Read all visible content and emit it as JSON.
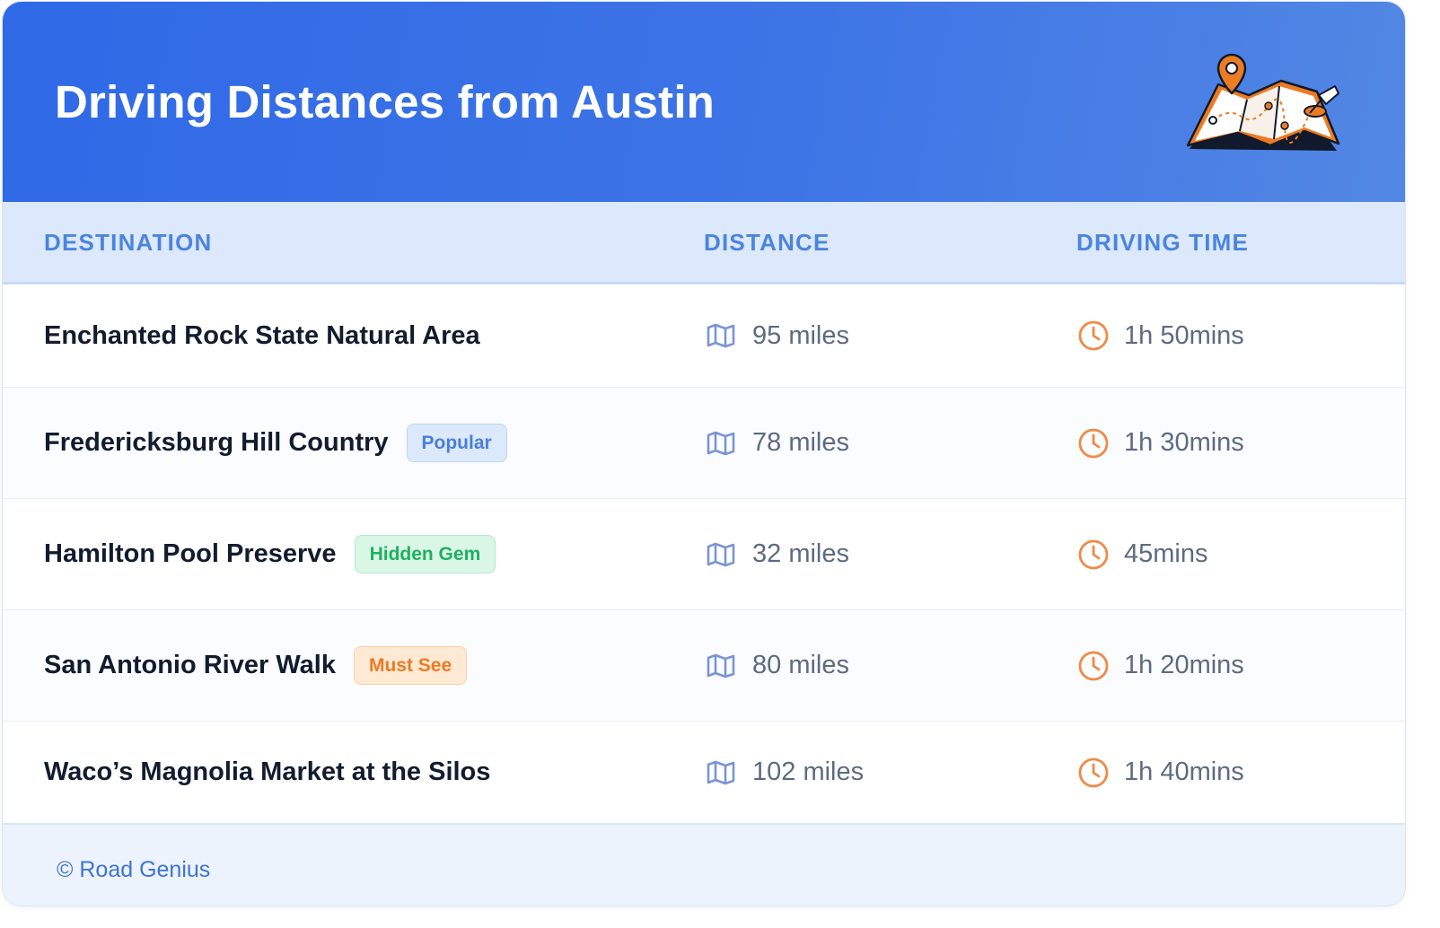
{
  "header": {
    "title": "Driving Distances from Austin"
  },
  "table": {
    "columns": [
      "DESTINATION",
      "DISTANCE",
      "DRIVING TIME"
    ],
    "rows": [
      {
        "destination": "Enchanted Rock State Natural Area",
        "badge": null,
        "distance": "95 miles",
        "time": "1h 50mins"
      },
      {
        "destination": "Fredericksburg Hill Country",
        "badge": "Popular",
        "badge_color": "#4a7ed9",
        "distance": "78 miles",
        "time": "1h 30mins"
      },
      {
        "destination": "Hamilton Pool Preserve",
        "badge": "Hidden Gem",
        "badge_color": "#1fb061",
        "distance": "32 miles",
        "time": "45mins"
      },
      {
        "destination": "San Antonio River Walk",
        "badge": "Must See",
        "badge_color": "#ec7b22",
        "distance": "80 miles",
        "time": "1h 20mins"
      },
      {
        "destination": "Waco’s Magnolia Market at the Silos",
        "badge": null,
        "distance": "102 miles",
        "time": "1h 40mins"
      }
    ],
    "distance_icon": "map-icon",
    "time_icon": "clock-icon"
  },
  "footer": {
    "credit": "© Road Genius"
  },
  "colors": {
    "header_gradient_start": "#2f69e6",
    "header_gradient_end": "#5287e4",
    "column_header_text": "#4a84df",
    "column_header_bg": "#dce8fc",
    "map_icon": "#7a95d4",
    "clock_icon": "#ef8a48",
    "footer_text": "#3e72d6"
  },
  "illustration": "map-with-location-pin"
}
